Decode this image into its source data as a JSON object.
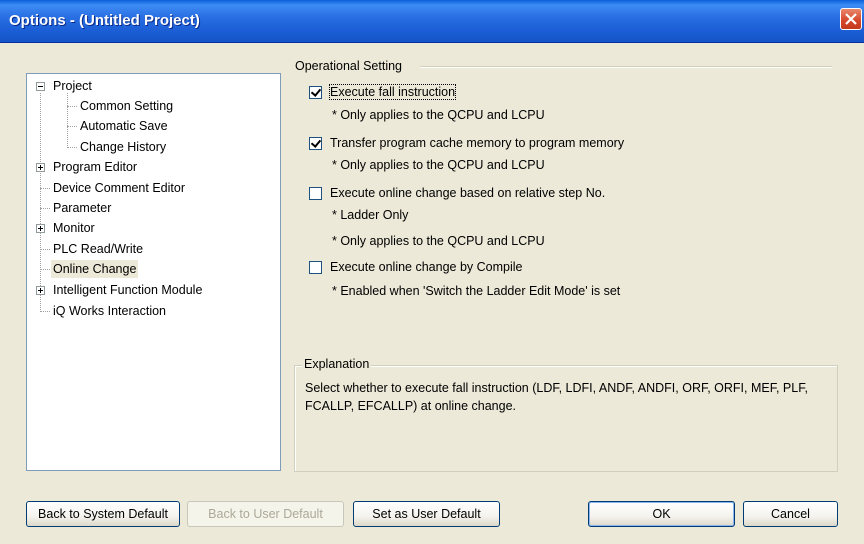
{
  "window": {
    "title": "Options - (Untitled Project)"
  },
  "tree": {
    "items": [
      {
        "label": "Project",
        "expander": "minus"
      },
      {
        "label": "Common Setting"
      },
      {
        "label": "Automatic Save"
      },
      {
        "label": "Change History"
      },
      {
        "label": "Program Editor",
        "expander": "plus"
      },
      {
        "label": "Device Comment Editor"
      },
      {
        "label": "Parameter"
      },
      {
        "label": "Monitor",
        "expander": "plus"
      },
      {
        "label": "PLC Read/Write"
      },
      {
        "label": "Online Change",
        "selected": true
      },
      {
        "label": "Intelligent Function Module",
        "expander": "plus"
      },
      {
        "label": "iQ Works Interaction"
      }
    ]
  },
  "operational": {
    "group_label": "Operational Setting",
    "options": [
      {
        "label": "Execute fall instruction",
        "checked": true,
        "notes": [
          "* Only applies to the QCPU and LCPU"
        ]
      },
      {
        "label": "Transfer program cache memory to program memory",
        "checked": true,
        "notes": [
          "* Only applies to the QCPU and LCPU"
        ]
      },
      {
        "label": "Execute online change based on relative step No.",
        "checked": false,
        "notes": [
          "* Ladder Only",
          "* Only applies to the QCPU and LCPU"
        ]
      },
      {
        "label": "Execute online change by Compile",
        "checked": false,
        "notes": [
          "* Enabled when 'Switch the Ladder Edit Mode' is set"
        ]
      }
    ]
  },
  "explanation": {
    "label": "Explanation",
    "text": "Select whether to execute fall instruction (LDF, LDFI, ANDF,  ANDFI, ORF, ORFI, MEF, PLF, FCALLP, EFCALLP) at online change."
  },
  "buttons": {
    "back_system": "Back to System Default",
    "back_user": "Back to User Default",
    "set_user": "Set as User Default",
    "ok": "OK",
    "cancel": "Cancel"
  }
}
